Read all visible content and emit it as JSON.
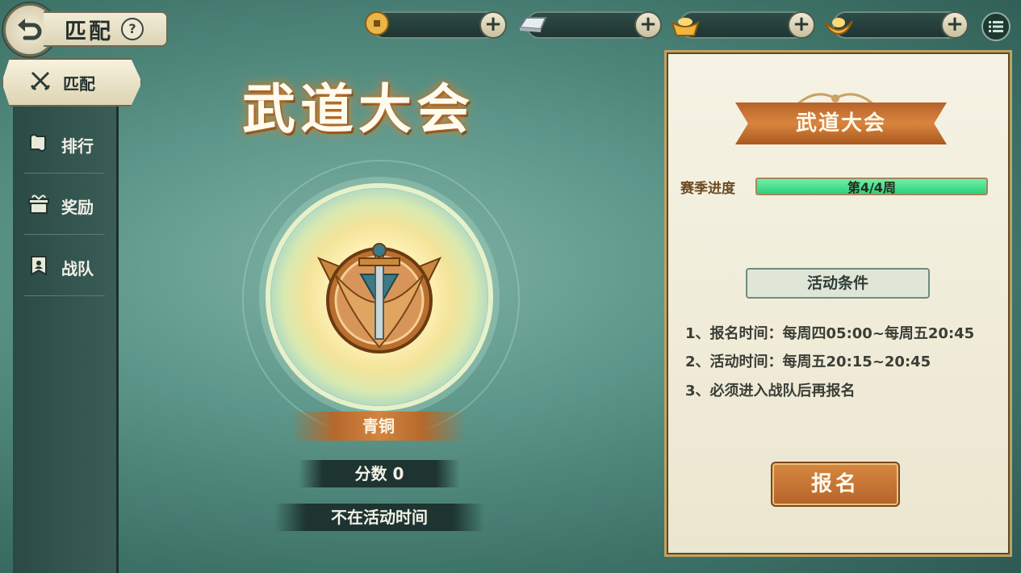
{
  "header": {
    "title": "匹配",
    "help_glyph": "?",
    "resources": [
      {
        "icon": "copper-coin-icon",
        "value": ""
      },
      {
        "icon": "silver-bar-icon",
        "value": ""
      },
      {
        "icon": "gold-ingot-icon",
        "value": ""
      },
      {
        "icon": "gold-yuanbao-icon",
        "value": ""
      }
    ],
    "plus_glyph": "+"
  },
  "sidebar": {
    "items": [
      {
        "label": "匹配",
        "icon": "crossed-swords-icon",
        "active": true
      },
      {
        "label": "排行",
        "icon": "scroll-icon",
        "active": false
      },
      {
        "label": "奖励",
        "icon": "gift-box-icon",
        "active": false
      },
      {
        "label": "战队",
        "icon": "team-banner-icon",
        "active": false
      }
    ]
  },
  "main": {
    "event_title": "武道大会",
    "rank_name": "青铜",
    "score_text": "分数  0",
    "status_text": "不在活动时间"
  },
  "panel": {
    "title": "武道大会",
    "progress_label": "赛季进度",
    "progress_text": "第4/4周",
    "progress_fraction": 1.0,
    "conditions_title": "活动条件",
    "rules": [
      "1、报名时间：每周四05:00~每周五20:45",
      "2、活动时间：每周五20:15~20:45",
      "3、必须进入战队后再报名"
    ],
    "signup_label": "报名"
  },
  "colors": {
    "accent_orange": "#c97635",
    "progress_green": "#3fdc8a",
    "panel_bg": "#f2eedc",
    "bg_teal": "#4f8579"
  }
}
